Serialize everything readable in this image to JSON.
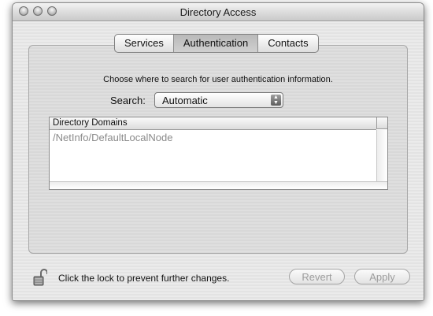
{
  "window": {
    "title": "Directory Access"
  },
  "tabs": [
    {
      "label": "Services",
      "selected": false
    },
    {
      "label": "Authentication",
      "selected": true
    },
    {
      "label": "Contacts",
      "selected": false
    }
  ],
  "instructions": "Choose where to search for user authentication information.",
  "search": {
    "label": "Search:",
    "value": "Automatic"
  },
  "table": {
    "header": "Directory Domains",
    "rows": [
      "/NetInfo/DefaultLocalNode"
    ]
  },
  "footer": {
    "lock_text": "Click the lock to prevent further changes.",
    "revert_label": "Revert",
    "apply_label": "Apply"
  },
  "icons": {
    "lock": "open-padlock-icon",
    "close": "close-icon",
    "minimize": "minimize-icon",
    "zoom": "zoom-icon",
    "popup": "up-down-arrows-icon"
  }
}
